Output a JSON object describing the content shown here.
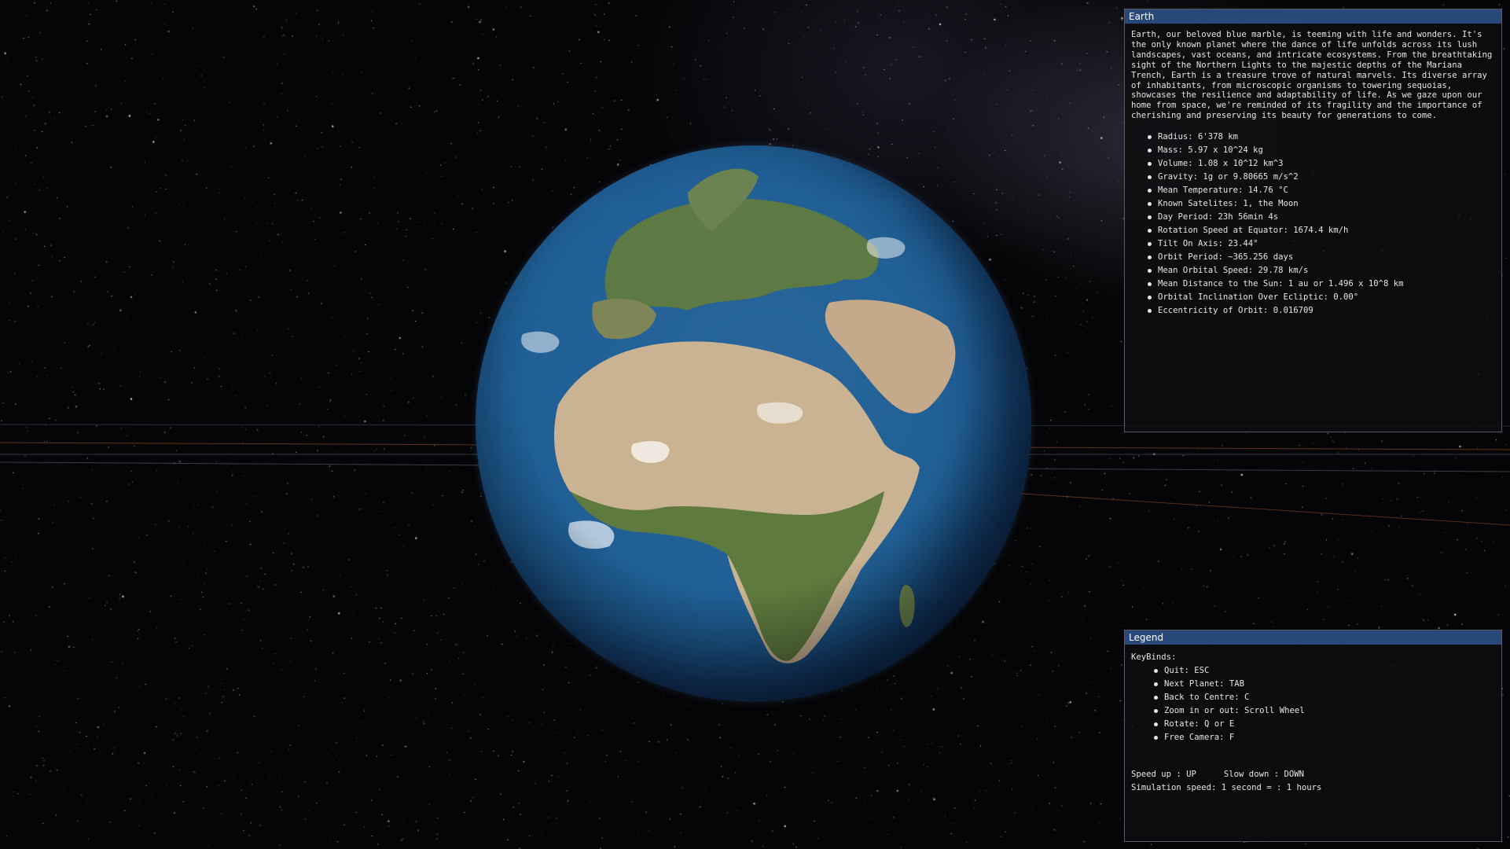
{
  "earth_panel": {
    "title": "Earth",
    "description": "Earth, our beloved blue marble, is teeming with life and wonders. It's the only known planet where the dance of life unfolds across its lush landscapes, vast oceans, and intricate ecosystems. From the breathtaking sight of the Northern Lights to the majestic depths of the Mariana Trench, Earth is a treasure trove of natural marvels. Its diverse array of inhabitants, from microscopic organisms to towering sequoias, showcases the resilience and adaptability of life. As we gaze upon our home from space, we're reminded of its fragility and the importance of cherishing and preserving its beauty for generations to come.",
    "stats": [
      "Radius: 6'378 km",
      "Mass: 5.97 x 10^24 kg",
      "Volume: 1.08 x 10^12 km^3",
      "Gravity: 1g or 9.80665 m/s^2",
      "Mean Temperature: 14.76 °C",
      "Known Satelites: 1, the Moon",
      "Day Period: 23h 56min 4s",
      "Rotation Speed at Equator: 1674.4 km/h",
      "Tilt On Axis: 23.44°",
      "Orbit Period: ~365.256 days",
      "Mean Orbital Speed: 29.78 km/s",
      "Mean Distance to the Sun: 1 au or 1.496 x 10^8 km",
      "Orbital Inclination Over Ecliptic: 0.00°",
      "Eccentricity of Orbit: 0.016709"
    ]
  },
  "legend_panel": {
    "title": "Legend",
    "keybinds_heading": "KeyBinds:",
    "keybinds": [
      "Quit: ESC",
      "Next Planet: TAB",
      "Back to Centre: C",
      "Zoom in or out: Scroll Wheel",
      "Rotate: Q or E",
      "Free Camera: F"
    ],
    "speed_up": "Speed up : UP",
    "slow_down": "Slow down : DOWN",
    "simulation_speed": "Simulation speed: 1 second = : 1 hours"
  },
  "colors": {
    "titlebar": "#29487a",
    "panel_bg": "#0e0e10",
    "ocean": "#1f5f96",
    "land_green": "#5d7a45",
    "land_desert": "#c9b392"
  }
}
